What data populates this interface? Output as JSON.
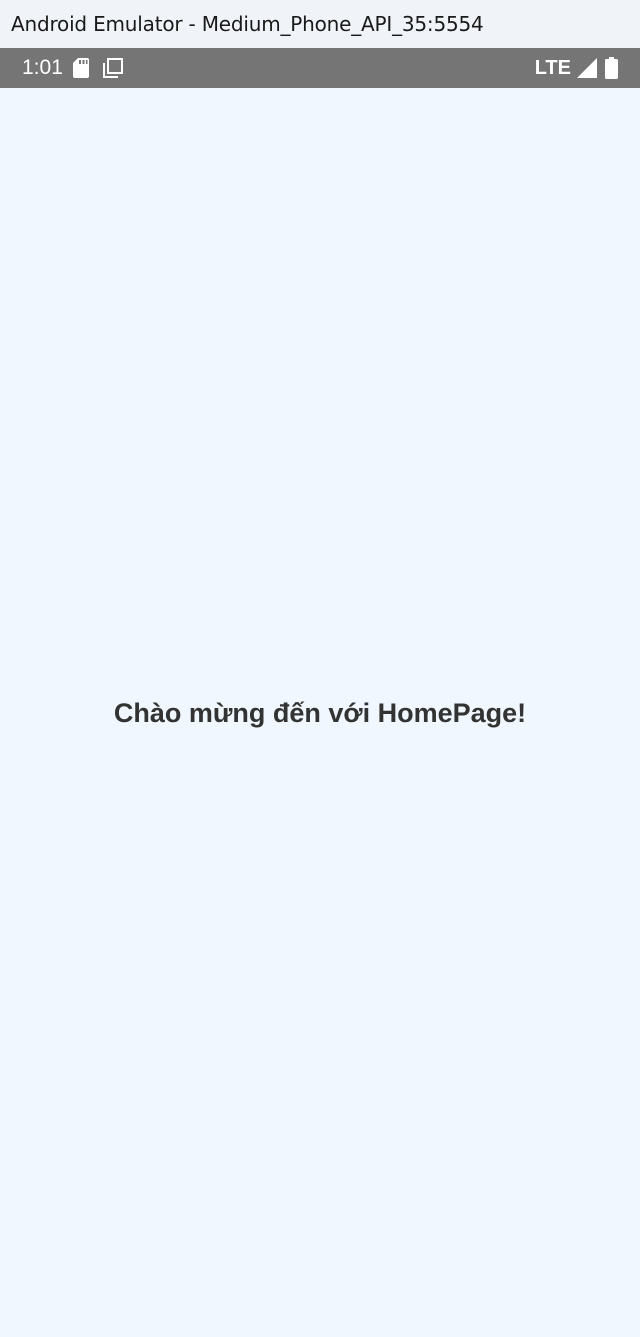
{
  "window": {
    "title": "Android Emulator - Medium_Phone_API_35:5554"
  },
  "status_bar": {
    "time": "1:01",
    "network": "LTE",
    "icons": [
      "sd-card-icon",
      "screen-capture-icon",
      "signal-icon",
      "battery-icon"
    ],
    "background": "#757575"
  },
  "home": {
    "welcome_text": "Chào mừng đến với HomePage!"
  },
  "colors": {
    "page_background": "#f1f7fe",
    "text": "#333333"
  }
}
